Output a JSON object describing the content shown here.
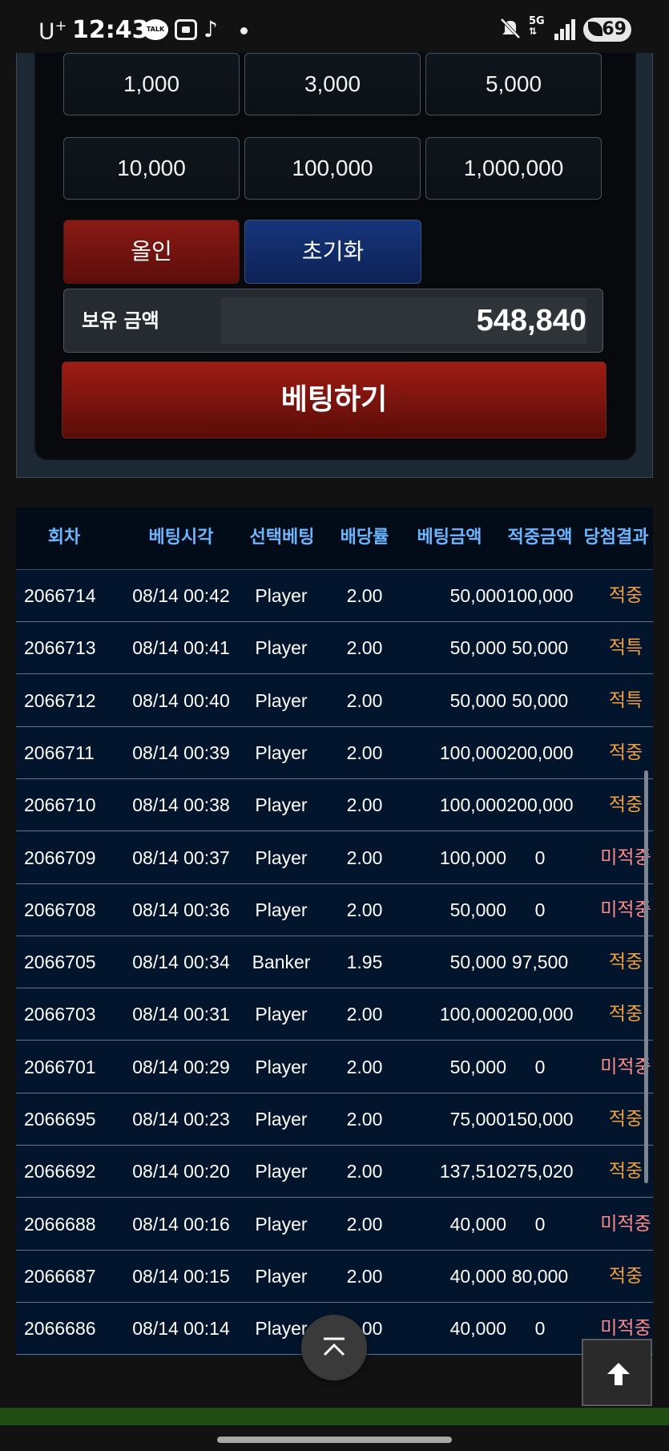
{
  "statusbar": {
    "carrier": "U",
    "carrier_sup": "+",
    "time": "12:43",
    "talk_label": "TALK",
    "network": "5G",
    "battery": "69",
    "icons": [
      "kakaotalk-icon",
      "scan-icon",
      "tiktok-icon",
      "dot-icon",
      "mute-icon",
      "5g-icon",
      "signal-icon",
      "battery-icon"
    ]
  },
  "betting": {
    "chips": [
      "1,000",
      "3,000",
      "5,000",
      "10,000",
      "100,000",
      "1,000,000"
    ],
    "allin_label": "올인",
    "reset_label": "초기화",
    "balance_label": "보유 금액",
    "balance_value": "548,840",
    "bet_button_label": "베팅하기",
    "colors": {
      "allin": "#8a1a14",
      "reset": "#15357a",
      "bet": "#9e1c14"
    }
  },
  "history": {
    "headers": {
      "round": "회차",
      "time": "베팅시각",
      "pick": "선택베팅",
      "odds": "배당률",
      "bet": "베팅금액",
      "win": "적중금액",
      "result": "당첨결과"
    },
    "header_color": "#6cb6ff",
    "rows": [
      {
        "round": "2066714",
        "time": "08/14 00:42",
        "pick": "Player",
        "odds": "2.00",
        "bet": "50,000",
        "win": "100,000",
        "result": "적중",
        "kind": "hit"
      },
      {
        "round": "2066713",
        "time": "08/14 00:41",
        "pick": "Player",
        "odds": "2.00",
        "bet": "50,000",
        "win": "50,000",
        "result": "적특",
        "kind": "special"
      },
      {
        "round": "2066712",
        "time": "08/14 00:40",
        "pick": "Player",
        "odds": "2.00",
        "bet": "50,000",
        "win": "50,000",
        "result": "적특",
        "kind": "special"
      },
      {
        "round": "2066711",
        "time": "08/14 00:39",
        "pick": "Player",
        "odds": "2.00",
        "bet": "100,000",
        "win": "200,000",
        "result": "적중",
        "kind": "hit"
      },
      {
        "round": "2066710",
        "time": "08/14 00:38",
        "pick": "Player",
        "odds": "2.00",
        "bet": "100,000",
        "win": "200,000",
        "result": "적중",
        "kind": "hit"
      },
      {
        "round": "2066709",
        "time": "08/14 00:37",
        "pick": "Player",
        "odds": "2.00",
        "bet": "100,000",
        "win": "0",
        "result": "미적중",
        "kind": "miss"
      },
      {
        "round": "2066708",
        "time": "08/14 00:36",
        "pick": "Player",
        "odds": "2.00",
        "bet": "50,000",
        "win": "0",
        "result": "미적중",
        "kind": "miss"
      },
      {
        "round": "2066705",
        "time": "08/14 00:34",
        "pick": "Banker",
        "odds": "1.95",
        "bet": "50,000",
        "win": "97,500",
        "result": "적중",
        "kind": "hit"
      },
      {
        "round": "2066703",
        "time": "08/14 00:31",
        "pick": "Player",
        "odds": "2.00",
        "bet": "100,000",
        "win": "200,000",
        "result": "적중",
        "kind": "hit"
      },
      {
        "round": "2066701",
        "time": "08/14 00:29",
        "pick": "Player",
        "odds": "2.00",
        "bet": "50,000",
        "win": "0",
        "result": "미적중",
        "kind": "miss"
      },
      {
        "round": "2066695",
        "time": "08/14 00:23",
        "pick": "Player",
        "odds": "2.00",
        "bet": "75,000",
        "win": "150,000",
        "result": "적중",
        "kind": "hit"
      },
      {
        "round": "2066692",
        "time": "08/14 00:20",
        "pick": "Player",
        "odds": "2.00",
        "bet": "137,510",
        "win": "275,020",
        "result": "적중",
        "kind": "hit"
      },
      {
        "round": "2066688",
        "time": "08/14 00:16",
        "pick": "Player",
        "odds": "2.00",
        "bet": "40,000",
        "win": "0",
        "result": "미적중",
        "kind": "miss"
      },
      {
        "round": "2066687",
        "time": "08/14 00:15",
        "pick": "Player",
        "odds": "2.00",
        "bet": "40,000",
        "win": "80,000",
        "result": "적중",
        "kind": "hit"
      },
      {
        "round": "2066686",
        "time": "08/14 00:14",
        "pick": "Player",
        "odds": "2.00",
        "bet": "40,000",
        "win": "0",
        "result": "미적중",
        "kind": "miss"
      }
    ]
  },
  "floating": {
    "scroll_top_icon": "double-chevron-up-icon",
    "back_to_top_icon": "arrow-up-icon"
  }
}
